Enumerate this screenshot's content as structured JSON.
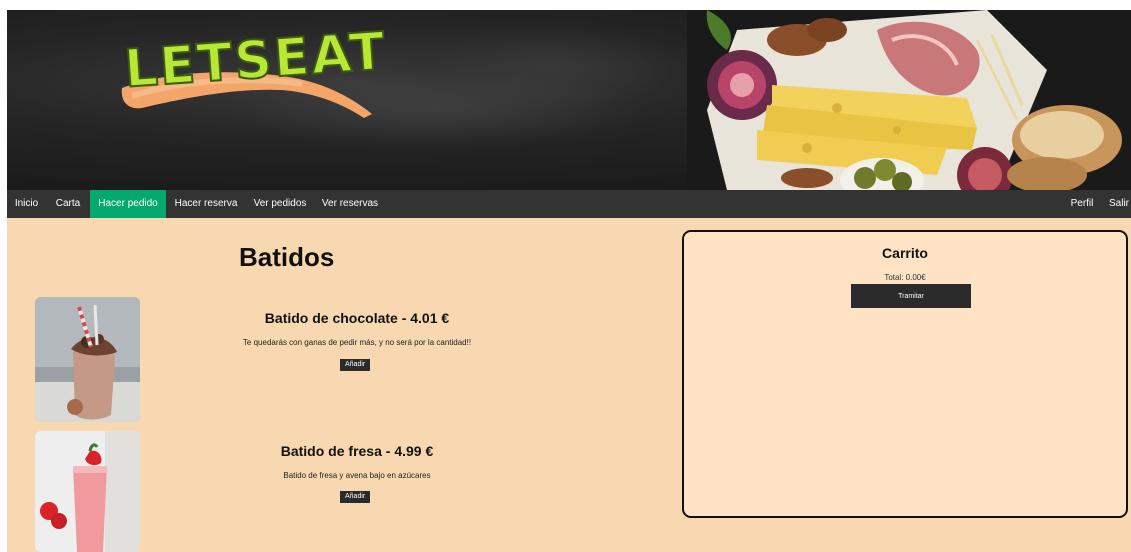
{
  "header": {
    "logo_text": "LETSEAT"
  },
  "nav": {
    "left_items": [
      {
        "label": "Inicio"
      },
      {
        "label": "Carta"
      },
      {
        "label": "Hacer pedido",
        "active": true
      },
      {
        "label": "Hacer reserva"
      },
      {
        "label": "Ver pedidos"
      },
      {
        "label": "Ver reservas"
      }
    ],
    "right_items": [
      {
        "label": "Perfil"
      },
      {
        "label": "Salir"
      }
    ]
  },
  "section": {
    "title": "Batidos"
  },
  "products": [
    {
      "name": "Batido de chocolate - 4.01 €",
      "description": "Te quedarás con ganas de pedir más, y no será por la cantidad!!",
      "button": "Añadir"
    },
    {
      "name": "Batido de fresa - 4.99 €",
      "description": "Batido de fresa y avena bajo en azúcares",
      "button": "Añadir"
    }
  ],
  "cart": {
    "title": "Carrito",
    "total": "Total: 0.00€",
    "button": "Tramitar"
  },
  "colors": {
    "page_bg": "#f8d8b0",
    "cart_bg": "#fde3c4",
    "navbar": "#333333",
    "nav_active": "#04aa6d",
    "button": "#2b2b2b",
    "logo_text": "#b8e835",
    "logo_brush": "#f4a66a"
  }
}
